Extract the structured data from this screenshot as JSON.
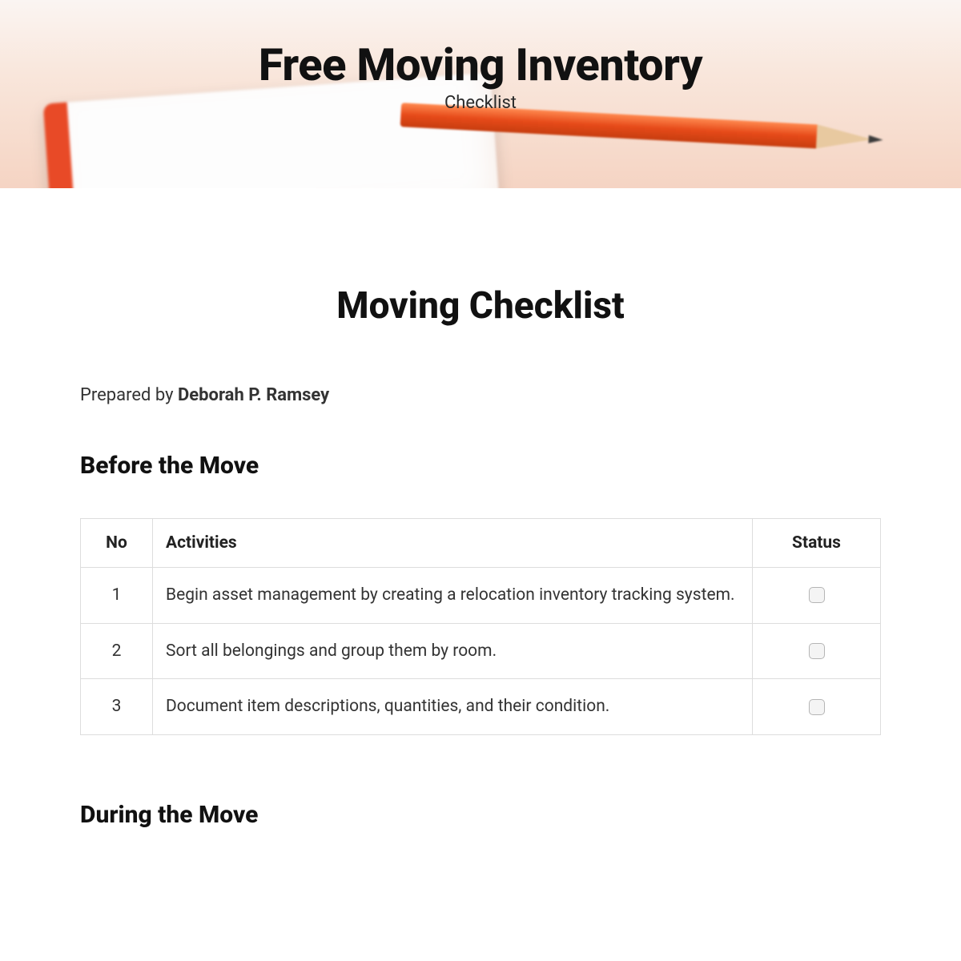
{
  "hero": {
    "title": "Free Moving Inventory",
    "subtitle": "Checklist"
  },
  "doc": {
    "title": "Moving Checklist",
    "prepared_label": "Prepared by ",
    "prepared_name": "Deborah P. Ramsey"
  },
  "sections": {
    "before": {
      "heading": "Before the Move",
      "columns": {
        "no": "No",
        "activities": "Activities",
        "status": "Status"
      },
      "rows": [
        {
          "no": "1",
          "activity": "Begin asset management by creating a relocation inventory tracking system."
        },
        {
          "no": "2",
          "activity": "Sort all belongings and group them by room."
        },
        {
          "no": "3",
          "activity": "Document item descriptions, quantities, and their condition."
        }
      ]
    },
    "during": {
      "heading": "During the Move"
    }
  }
}
